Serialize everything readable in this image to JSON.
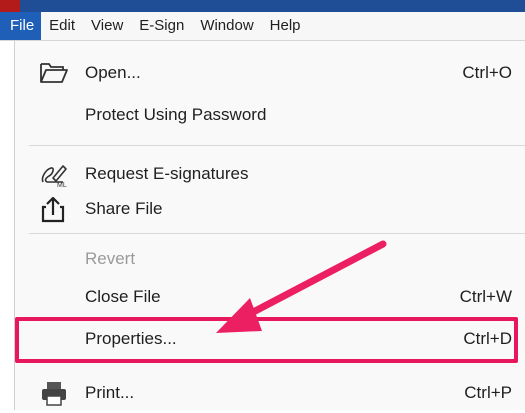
{
  "menubar": {
    "items": [
      {
        "label": "File",
        "active": true
      },
      {
        "label": "Edit"
      },
      {
        "label": "View"
      },
      {
        "label": "E-Sign"
      },
      {
        "label": "Window"
      },
      {
        "label": "Help"
      }
    ]
  },
  "file_menu": {
    "open": {
      "label": "Open...",
      "shortcut": "Ctrl+O",
      "icon": "folder-open-icon"
    },
    "protect": {
      "label": "Protect Using Password"
    },
    "request_esign": {
      "label": "Request E-signatures",
      "icon": "pen-signature-icon"
    },
    "share": {
      "label": "Share File",
      "icon": "share-icon"
    },
    "revert": {
      "label": "Revert",
      "disabled": true
    },
    "close": {
      "label": "Close File",
      "shortcut": "Ctrl+W"
    },
    "properties": {
      "label": "Properties...",
      "shortcut": "Ctrl+D",
      "highlighted": true
    },
    "print": {
      "label": "Print...",
      "shortcut": "Ctrl+P",
      "icon": "printer-icon"
    }
  },
  "colors": {
    "highlight": "#e8175d",
    "menu_active": "#1f5fb8",
    "title_bar": "#1f4e96"
  }
}
